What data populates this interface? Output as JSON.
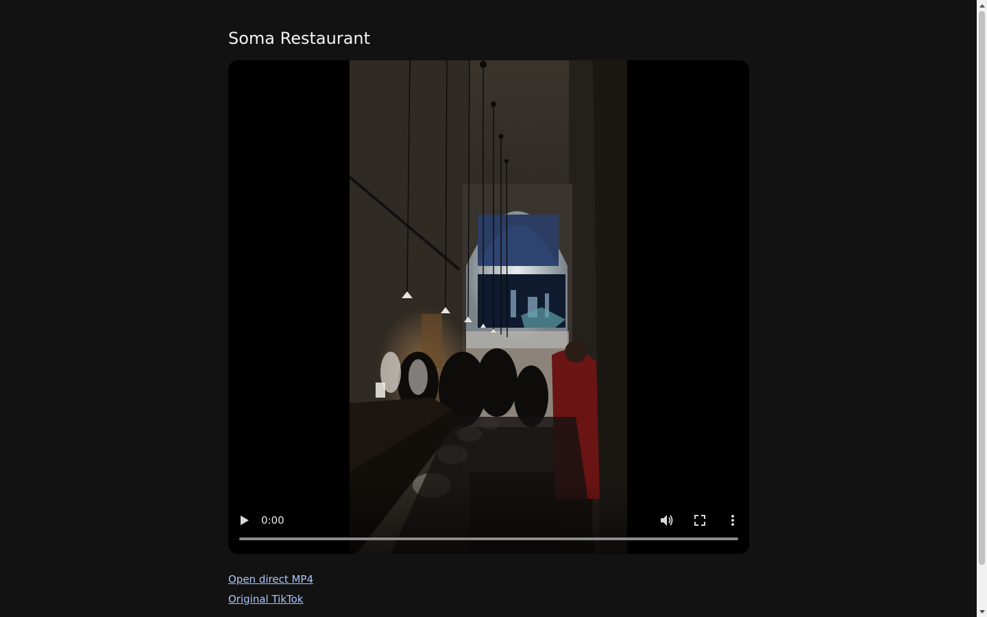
{
  "page": {
    "title": "Soma Restaurant"
  },
  "video": {
    "time": "0:00",
    "progress": 0,
    "controls": {
      "play_icon": "play-icon",
      "volume_icon": "volume-icon",
      "fullscreen_icon": "fullscreen-icon",
      "more_icon": "more-vertical-icon"
    }
  },
  "links": {
    "direct_mp4": "Open direct MP4",
    "original_tiktok": "Original TikTok"
  },
  "colors": {
    "background": "#121212",
    "link": "#a8c7fa",
    "title": "#f2f2f2"
  }
}
